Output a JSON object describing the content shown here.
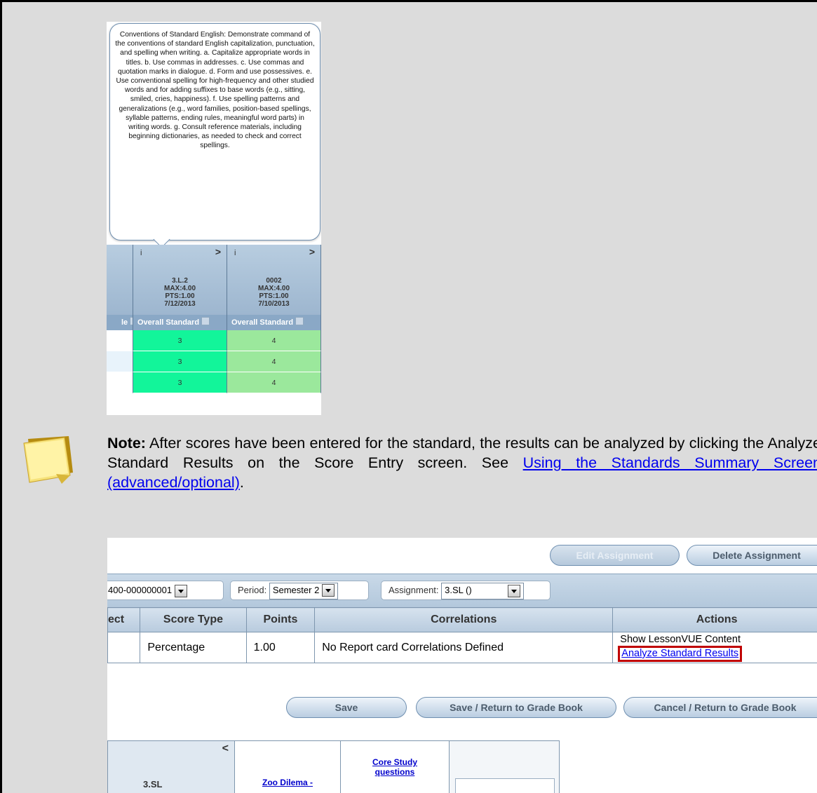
{
  "tooltip": {
    "text": "Conventions of Standard English: Demonstrate command of the conventions of standard English capitalization, punctuation, and spelling when writing. a. Capitalize appropriate words in titles. b. Use commas in addresses. c. Use commas and quotation marks in dialogue. d. Form and use possessives. e. Use conventional spelling for high-frequency and other studied words and for adding suffixes to base words (e.g., sitting, smiled, cries, happiness). f. Use spelling patterns and generalizations (e.g., word families, position-based spellings, syllable patterns, ending rules, meaningful word parts) in writing words. g. Consult reference materials, including beginning dictionaries, as needed to check and correct spellings."
  },
  "grid": {
    "left_header_partial": "le",
    "columns": [
      {
        "info": "i",
        "chevron": ">",
        "code": "3.L.2",
        "max": "MAX:4.00",
        "pts": "PTS:1.00",
        "date": "7/12/2013",
        "sub_label": "Overall Standard",
        "values": [
          "3",
          "3",
          "3"
        ]
      },
      {
        "info": "i",
        "chevron": ">",
        "code": "0002",
        "max": "MAX:4.00",
        "pts": "PTS:1.00",
        "date": "7/10/2013",
        "sub_label": "Overall Standard",
        "values": [
          "4",
          "4",
          "4"
        ]
      }
    ],
    "sort_marker": "S"
  },
  "note": {
    "bold_label": "Note:",
    "text": " After scores have been entered for the standard, the results can be analyzed by clicking the Analyze Standard Results on the Score Entry screen. See ",
    "link_text": "Using the Standards Summary Screen (advanced/optional)",
    "trailing": "."
  },
  "score_entry": {
    "buttons": {
      "edit_assignment": "Edit Assignment",
      "delete_assignment": "Delete Assignment",
      "save": "Save",
      "save_return": "Save / Return to Grade Book",
      "cancel_return": "Cancel / Return to Grade Book"
    },
    "filters": {
      "section_value": "400-000000001",
      "period_label": "Period:",
      "period_value": "Semester 2",
      "assignment_label": "Assignment:",
      "assignment_value": "3.SL ()"
    },
    "table": {
      "headers": [
        "ect",
        "Score Type",
        "Points",
        "Correlations",
        "Actions"
      ],
      "row": {
        "score_type": "Percentage",
        "points": "1.00",
        "correlations": "No Report card Correlations Defined",
        "action_show": "Show LessonVUE Content",
        "action_analyze": "Analyze Standard Results"
      }
    },
    "standard_grid": {
      "label": "3.SL",
      "chevron": "<",
      "link1": "Zoo Dilema -",
      "link2": "Core Study questions"
    }
  }
}
